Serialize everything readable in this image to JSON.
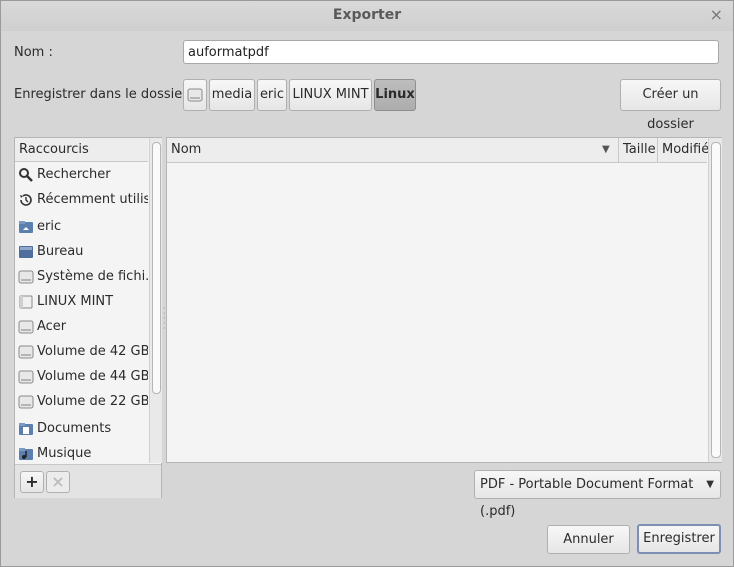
{
  "window": {
    "title": "Exporter",
    "close_glyph": "×"
  },
  "name_row": {
    "label": "Nom :",
    "value": "auformatpdf"
  },
  "folder_row": {
    "label": "Enregistrer dans le dossier :",
    "path": [
      {
        "icon": "drive-icon",
        "label": ""
      },
      {
        "label": "media"
      },
      {
        "label": "eric"
      },
      {
        "label": "LINUX MINT"
      },
      {
        "label": "Linux",
        "active": true
      }
    ],
    "create_folder": "Créer un dossier"
  },
  "sidebar": {
    "header": "Raccourcis",
    "items": [
      {
        "label": "Rechercher",
        "icon": "search-icon"
      },
      {
        "label": "Récemment utilis...",
        "icon": "recent-icon"
      },
      {
        "label": "eric",
        "icon": "home-folder-icon"
      },
      {
        "label": "Bureau",
        "icon": "desktop-icon"
      },
      {
        "label": "Système de fichi...",
        "icon": "drive-icon"
      },
      {
        "label": "LINUX MINT",
        "icon": "drive-icon"
      },
      {
        "label": "Acer",
        "icon": "drive-icon"
      },
      {
        "label": "Volume de 42 GB",
        "icon": "drive-icon"
      },
      {
        "label": "Volume de 44 GB",
        "icon": "drive-icon"
      },
      {
        "label": "Volume de 22 GB",
        "icon": "drive-icon"
      },
      {
        "label": "Documents",
        "icon": "documents-folder-icon"
      },
      {
        "label": "Musique",
        "icon": "music-folder-icon"
      }
    ],
    "add_glyph": "+",
    "remove_glyph": "×"
  },
  "files": {
    "columns": {
      "name": "Nom",
      "size": "Taille",
      "modified": "Modifié"
    },
    "sort_glyph": "▼"
  },
  "filetype": {
    "value": "PDF - Portable Document Format (.pdf)",
    "arrow_glyph": "▼"
  },
  "actions": {
    "cancel": "Annuler",
    "save": "Enregistrer"
  }
}
